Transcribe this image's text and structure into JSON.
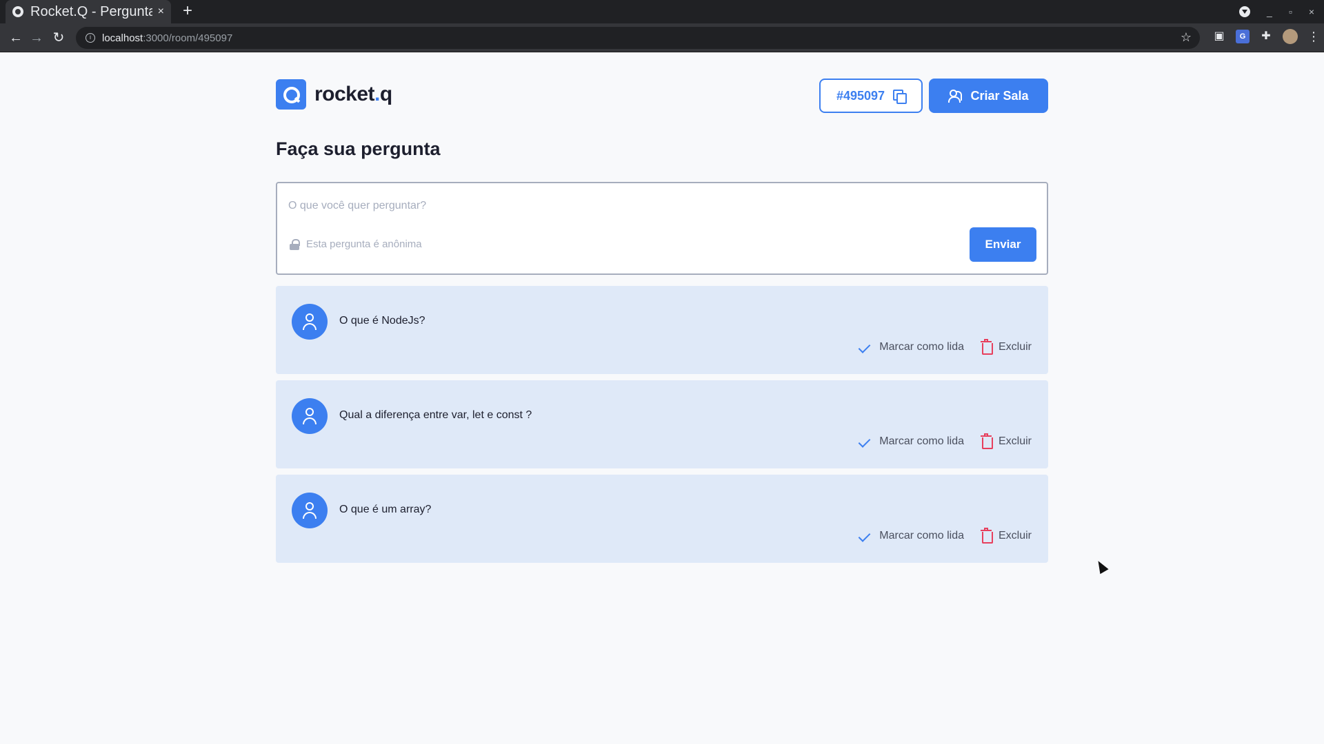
{
  "browser": {
    "tab_title": "Rocket.Q - Pergunta",
    "tab_close": "×",
    "new_tab": "+",
    "url_host": "localhost",
    "url_path": ":3000/room/495097",
    "window_controls": [
      "_",
      "▫",
      "×"
    ]
  },
  "header": {
    "logo_text": "rocket",
    "logo_dot": ".",
    "logo_suffix": "q",
    "room_code": "#495097",
    "create_room_label": "Criar Sala"
  },
  "ask": {
    "title": "Faça sua pergunta",
    "placeholder": "O que você quer perguntar?",
    "anonymous_note": "Esta pergunta é anônima",
    "send_label": "Enviar"
  },
  "questions": [
    {
      "text": "O que é NodeJs?",
      "mark_read_label": "Marcar como lida",
      "delete_label": "Excluir"
    },
    {
      "text": "Qual a diferença entre var, let e const ?",
      "mark_read_label": "Marcar como lida",
      "delete_label": "Excluir"
    },
    {
      "text": "O que é um array?",
      "mark_read_label": "Marcar como lida",
      "delete_label": "Excluir"
    }
  ],
  "colors": {
    "accent": "#3c7ff0",
    "danger": "#e73f5d",
    "question_bg": "#dfe9f8",
    "text_dark": "#1d1f2e"
  }
}
